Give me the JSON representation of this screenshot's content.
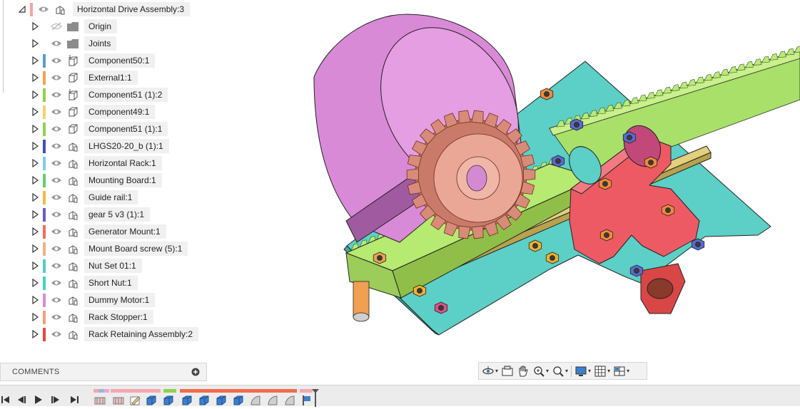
{
  "browser": {
    "root": {
      "label": "Horizontal Drive Assembly:3",
      "color": "#f2a6a0"
    },
    "items": [
      {
        "label": "Origin",
        "type": "folder",
        "color": null,
        "visible": false
      },
      {
        "label": "Joints",
        "type": "folder",
        "color": null,
        "visible": true
      },
      {
        "label": "Component50:1",
        "type": "component-ground",
        "color": "#5b9bd5",
        "visible": true
      },
      {
        "label": "External1:1",
        "type": "component",
        "color": "#f4a259",
        "visible": true
      },
      {
        "label": "Component51 (1):2",
        "type": "component-ground",
        "color": "#8fd14f",
        "visible": true
      },
      {
        "label": "Component49:1",
        "type": "component",
        "color": "#f2d16b",
        "visible": true
      },
      {
        "label": "Component51 (1):1",
        "type": "component",
        "color": "#8fd14f",
        "visible": true
      },
      {
        "label": "LHGS20-20_b (1):1",
        "type": "assembly",
        "color": "#3f4fb5",
        "visible": true
      },
      {
        "label": "Horizontal Rack:1",
        "type": "assembly",
        "color": "#7ecbf2",
        "visible": true
      },
      {
        "label": "Mounting Board:1",
        "type": "assembly",
        "color": "#66cc66",
        "visible": true
      },
      {
        "label": "Guide rail:1",
        "type": "assembly",
        "color": "#f5b942",
        "visible": true
      },
      {
        "label": "gear 5 v3 (1):1",
        "type": "assembly",
        "color": "#6a5acd",
        "visible": true
      },
      {
        "label": "Generator Mount:1",
        "type": "assembly",
        "color": "#f26b5b",
        "visible": true
      },
      {
        "label": "Mount Board screw (5):1",
        "type": "assembly",
        "color": "#f4b183",
        "visible": true
      },
      {
        "label": "Nut Set 01:1",
        "type": "assembly",
        "color": "#4fd1c5",
        "visible": true
      },
      {
        "label": "Short Nut:1",
        "type": "assembly",
        "color": "#3fd6c0",
        "visible": true
      },
      {
        "label": "Dummy Motor:1",
        "type": "assembly",
        "color": "#d98cd9",
        "visible": true
      },
      {
        "label": "Rack Stopper:1",
        "type": "assembly",
        "color": "#f4a07a",
        "visible": true
      },
      {
        "label": "Rack Retaining Assembly:2",
        "type": "assembly",
        "color": "#e64a3c",
        "visible": true
      }
    ]
  },
  "comments": {
    "title": "COMMENTS"
  },
  "navbar": {
    "tools": [
      "orbit-icon",
      "look-at-icon",
      "pan-icon",
      "zoom-window-icon",
      "zoom-icon",
      "display-settings-icon",
      "grid-settings-icon",
      "viewports-icon"
    ]
  },
  "timeline": {
    "controls": [
      "go-to-start-icon",
      "step-back-icon",
      "play-icon",
      "step-forward-icon",
      "go-to-end-icon"
    ]
  },
  "colors": {
    "motor": "#d98ad6",
    "board": "#5ccfc6",
    "rack": "#a8e06a",
    "gear": "#e8a08f",
    "mount": "#e8505b",
    "rail": "#d9c36a"
  }
}
